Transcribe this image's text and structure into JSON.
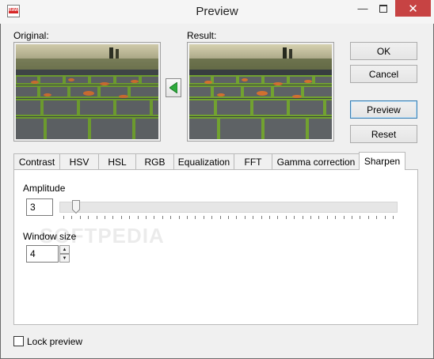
{
  "window": {
    "title": "Preview",
    "icon": "raw-image-icon",
    "icon_text": "RAW",
    "close_glyph": "✕",
    "minimize_glyph": "—"
  },
  "panels": {
    "original_label": "Original:",
    "result_label": "Result:"
  },
  "buttons": {
    "ok": "OK",
    "cancel": "Cancel",
    "preview": "Preview",
    "reset": "Reset"
  },
  "tabs": [
    {
      "label": "Contrast",
      "active": false
    },
    {
      "label": "HSV",
      "active": false
    },
    {
      "label": "HSL",
      "active": false
    },
    {
      "label": "RGB",
      "active": false
    },
    {
      "label": "Equalization",
      "active": false
    },
    {
      "label": "FFT",
      "active": false
    },
    {
      "label": "Gamma correction",
      "active": false
    },
    {
      "label": "Sharpen",
      "active": true
    }
  ],
  "sharpen": {
    "amplitude_label": "Amplitude",
    "amplitude_value": "3",
    "window_size_label": "Window size",
    "window_size_value": "4"
  },
  "footer": {
    "lock_preview_label": "Lock preview",
    "lock_preview_checked": false
  },
  "watermark": "SOFTPEDIA",
  "colors": {
    "accent_arrow": "#2eaa3c",
    "close_button": "#c74343",
    "moss": "#6c9a2e",
    "stone": "#4a4d4f",
    "leaf": "#c76a2f"
  }
}
